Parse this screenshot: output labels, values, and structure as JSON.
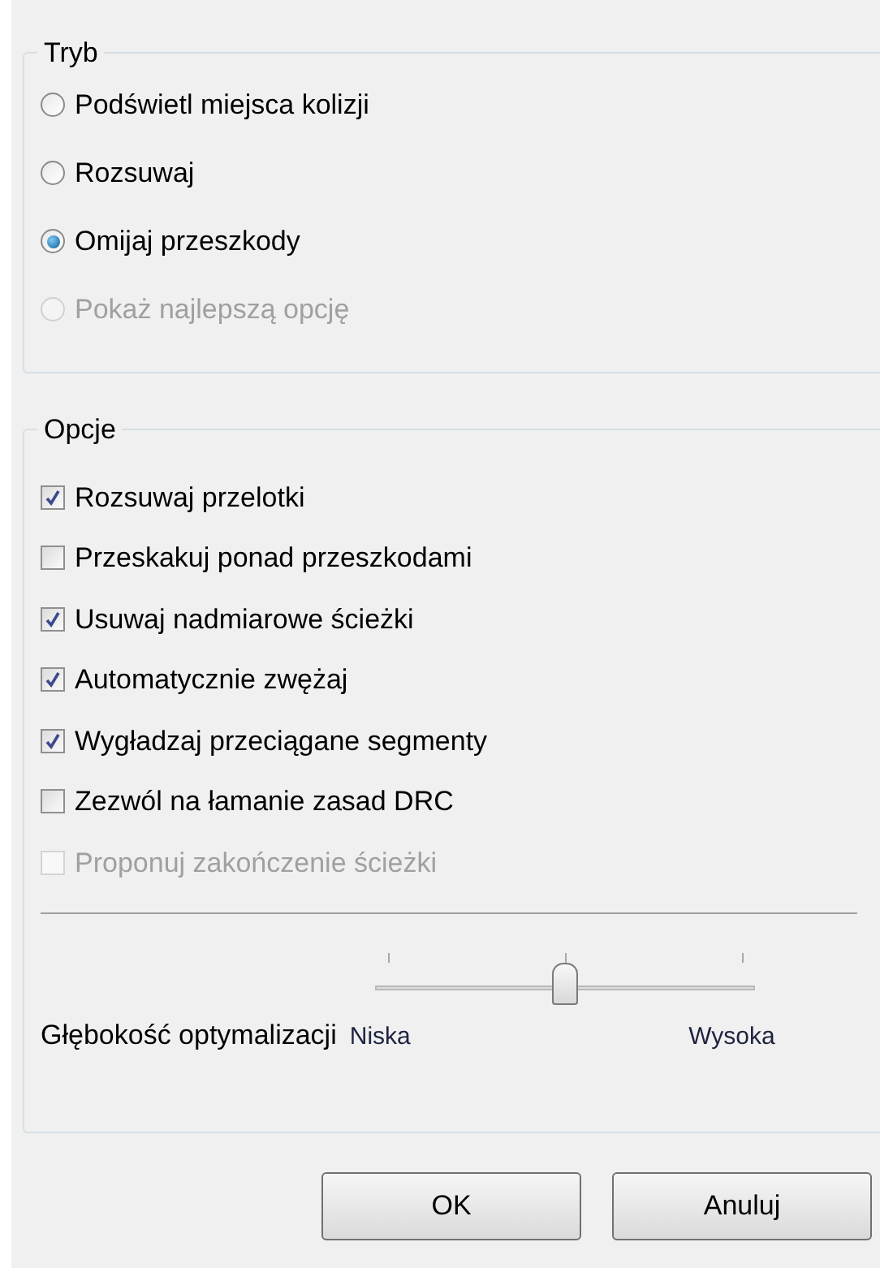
{
  "mode_group": {
    "title": "Tryb",
    "options": [
      {
        "label": "Podświetl miejsca kolizji",
        "selected": false,
        "disabled": false
      },
      {
        "label": "Rozsuwaj",
        "selected": false,
        "disabled": false
      },
      {
        "label": "Omijaj przeszkody",
        "selected": true,
        "disabled": false
      },
      {
        "label": "Pokaż najlepszą opcję",
        "selected": false,
        "disabled": true
      }
    ]
  },
  "options_group": {
    "title": "Opcje",
    "checkboxes": [
      {
        "label": "Rozsuwaj przelotki",
        "checked": true,
        "disabled": false
      },
      {
        "label": "Przeskakuj ponad przeszkodami",
        "checked": false,
        "disabled": false
      },
      {
        "label": "Usuwaj nadmiarowe ścieżki",
        "checked": true,
        "disabled": false
      },
      {
        "label": "Automatycznie zwężaj",
        "checked": true,
        "disabled": false
      },
      {
        "label": "Wygładzaj przeciągane segmenty",
        "checked": true,
        "disabled": false
      },
      {
        "label": "Zezwól na łamanie zasad DRC",
        "checked": false,
        "disabled": false
      },
      {
        "label": "Proponuj zakończenie ścieżki",
        "checked": false,
        "disabled": true
      }
    ],
    "slider": {
      "label": "Głębokość optymalizacji",
      "level": 0.5,
      "min_label": "Niska",
      "max_label": "Wysoka"
    }
  },
  "buttons": [
    "OK",
    "Anuluj"
  ]
}
